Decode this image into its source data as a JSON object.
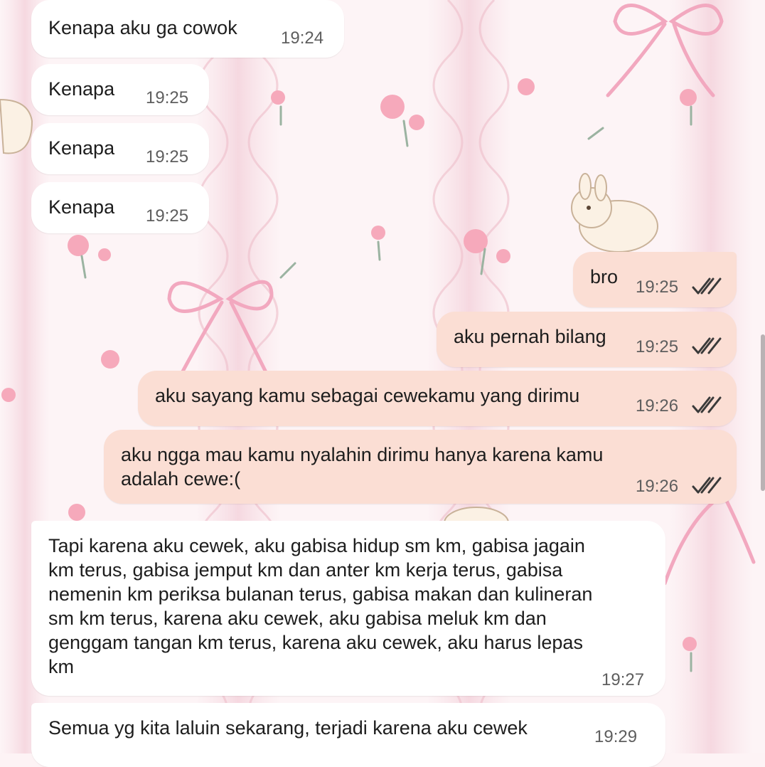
{
  "theme": {
    "incoming_bubble_color": "#ffffff",
    "outgoing_bubble_color": "#fbded4",
    "read_tick_color": "#3a3a3a"
  },
  "messages": [
    {
      "direction": "incoming",
      "text": "Kenapa aku ga cowok",
      "time": "19:24"
    },
    {
      "direction": "incoming",
      "text": "Kenapa",
      "time": "19:25"
    },
    {
      "direction": "incoming",
      "text": "Kenapa",
      "time": "19:25"
    },
    {
      "direction": "incoming",
      "text": "Kenapa",
      "time": "19:25"
    },
    {
      "direction": "outgoing",
      "text": "bro",
      "time": "19:25",
      "status": "read-double-check-icon"
    },
    {
      "direction": "outgoing",
      "text": "aku pernah bilang",
      "time": "19:25",
      "status": "read-double-check-icon"
    },
    {
      "direction": "outgoing",
      "text": "aku sayang kamu sebagai cewekamu yang dirimu",
      "time": "19:26",
      "status": "read-double-check-icon"
    },
    {
      "direction": "outgoing",
      "text": "aku ngga mau kamu nyalahin dirimu hanya karena kamu\nadalah cewe:(",
      "time": "19:26",
      "status": "read-double-check-icon"
    },
    {
      "direction": "incoming",
      "text": "Tapi karena aku cewek, aku gabisa hidup sm km, gabisa jagain\nkm terus, gabisa jemput km dan anter km kerja terus, gabisa\nnemenin km periksa bulanan terus, gabisa makan dan kulineran\nsm km terus, karena aku cewek, aku gabisa meluk km dan\ngenggam tangan km terus, karena aku cewek, aku harus lepas\nkm",
      "time": "19:27"
    },
    {
      "direction": "incoming",
      "text": "Semua yg kita laluin sekarang, terjadi karena aku cewek",
      "time": "19:29"
    }
  ]
}
